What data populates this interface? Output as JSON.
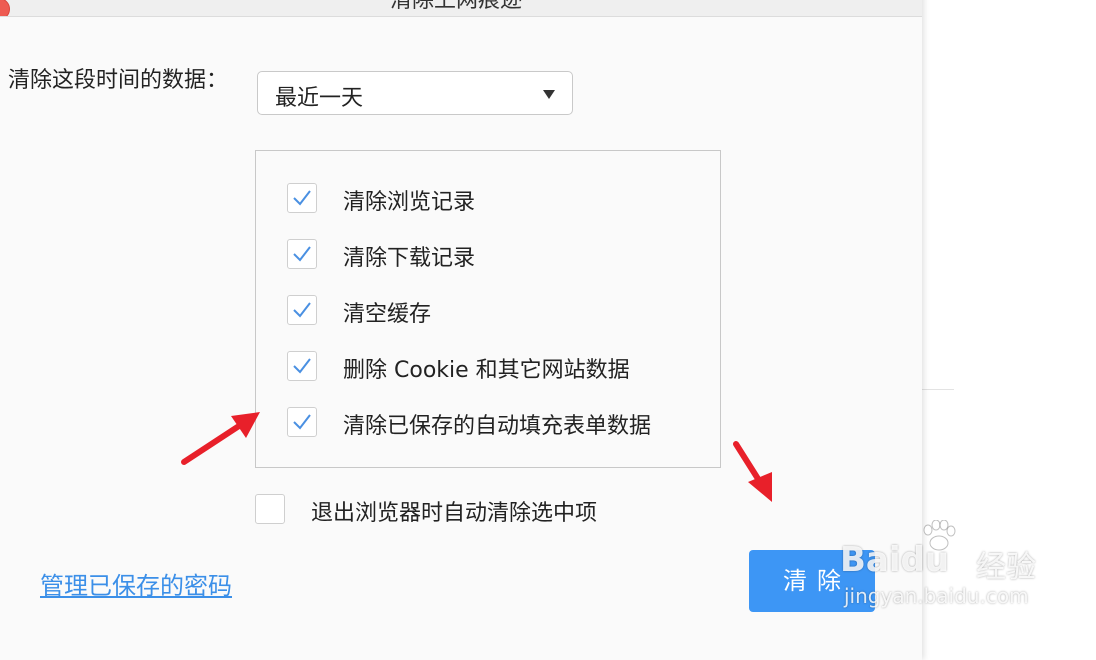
{
  "dialog": {
    "title": "清除上网痕迹",
    "period_label": "清除这段时间的数据：",
    "period_value": "最近一天",
    "options": [
      {
        "label": "清除浏览记录",
        "checked": true
      },
      {
        "label": "清除下载记录",
        "checked": true
      },
      {
        "label": "清空缓存",
        "checked": true
      },
      {
        "label": "删除 Cookie 和其它网站数据",
        "checked": true
      },
      {
        "label": "清除已保存的自动填充表单数据",
        "checked": true
      }
    ],
    "exit_option": {
      "label": "退出浏览器时自动清除选中项",
      "checked": false
    },
    "manage_link": "管理已保存的密码",
    "clear_button": "清除"
  },
  "watermark": {
    "brand": "Baidu",
    "brand_suffix": "经验",
    "url": "jingyan.baidu.com"
  },
  "colors": {
    "accent": "#3d96f5",
    "link": "#3b8fe8",
    "check": "#4a90e2",
    "arrow": "#e8202a"
  }
}
